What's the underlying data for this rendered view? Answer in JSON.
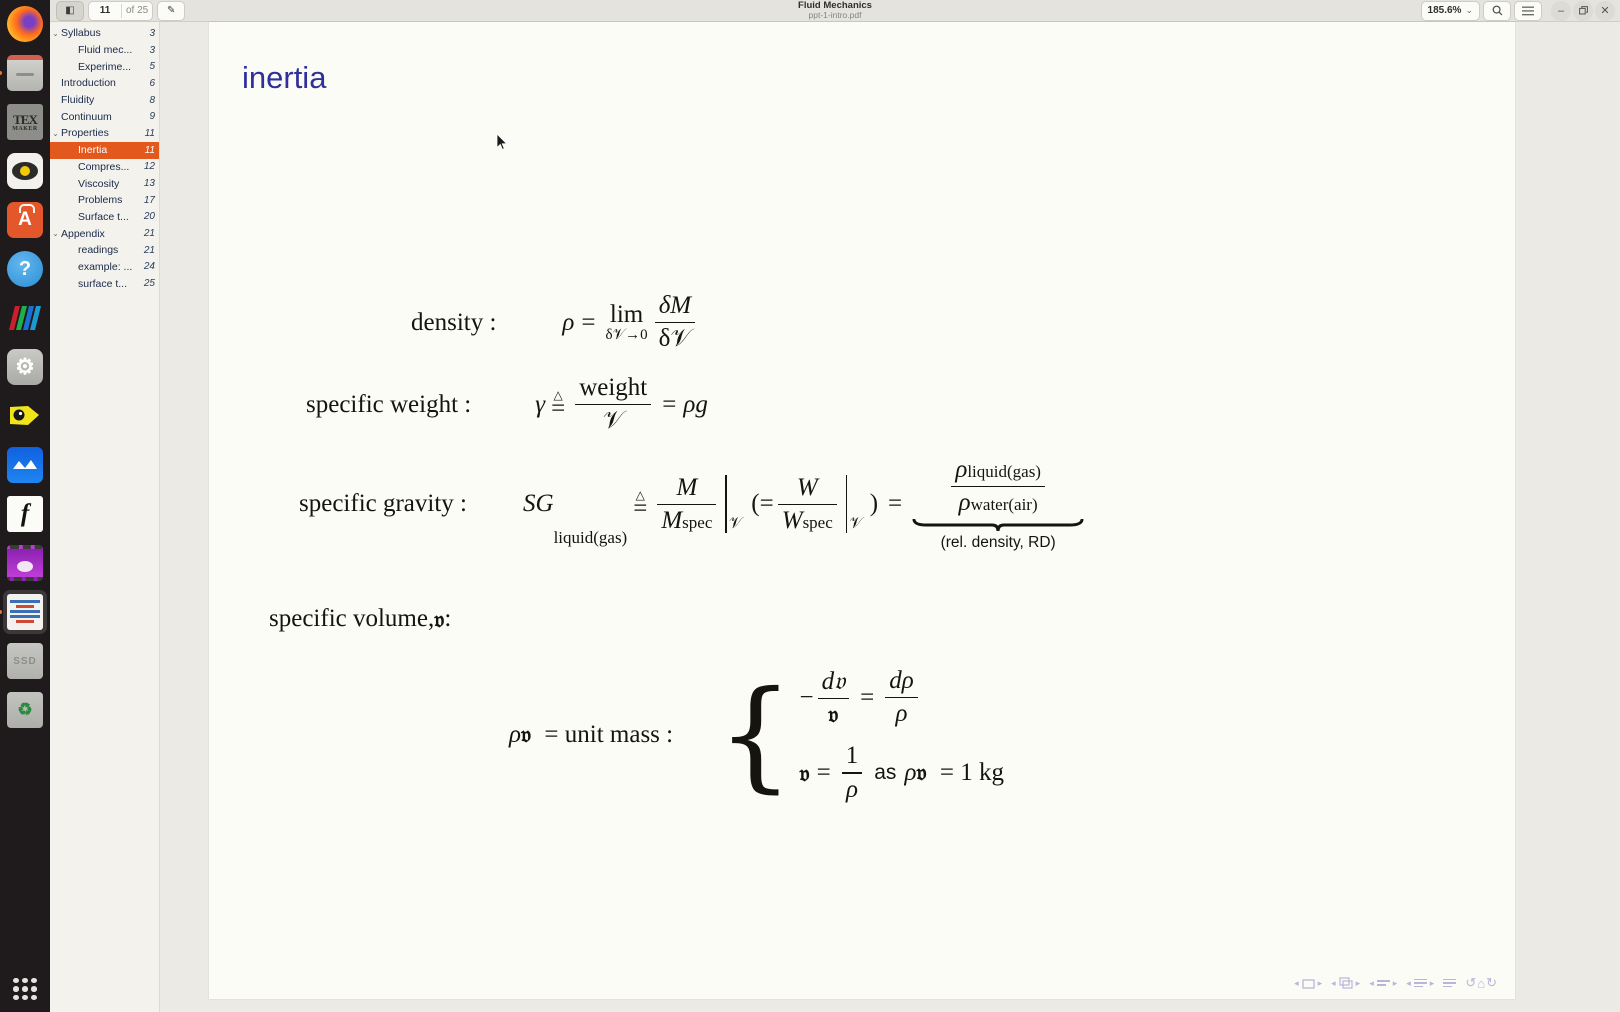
{
  "dock": {
    "items": [
      {
        "name": "firefox",
        "label": "Firefox",
        "running": false,
        "active": false
      },
      {
        "name": "files",
        "label": "Files",
        "running": true,
        "active": false
      },
      {
        "name": "texmaker",
        "label": "Texmaker",
        "tex_top": "TEX",
        "tex_bottom": "MAKER",
        "running": false,
        "active": false
      },
      {
        "name": "document-viewer",
        "label": "Document Viewer",
        "running": false,
        "active": false
      },
      {
        "name": "ubuntu-software",
        "label": "Ubuntu Software",
        "glyph": "A",
        "running": false,
        "active": false
      },
      {
        "name": "help",
        "label": "Help",
        "glyph": "?",
        "running": false,
        "active": false
      },
      {
        "name": "stripes-app",
        "label": "Color Stripes",
        "running": false,
        "active": false
      },
      {
        "name": "settings",
        "label": "Settings",
        "glyph": "⚙",
        "running": false,
        "active": false
      },
      {
        "name": "snake-app",
        "label": "Snake",
        "running": false,
        "active": false
      },
      {
        "name": "wave-app",
        "label": "Wave",
        "glyph": "▲▲",
        "running": false,
        "active": false
      },
      {
        "name": "font-app",
        "label": "Fonts",
        "glyph": "f",
        "running": false,
        "active": false
      },
      {
        "name": "video-app",
        "label": "Videos",
        "running": false,
        "active": false
      },
      {
        "name": "pdf-viewer",
        "label": "PDF Viewer",
        "running": true,
        "active": true
      },
      {
        "name": "ssd-drive",
        "label": "SSD",
        "glyph": "SSD",
        "running": false,
        "active": false
      },
      {
        "name": "trash",
        "label": "Trash",
        "glyph": "♻",
        "running": false,
        "active": false
      }
    ],
    "show_apps_label": "Show Applications"
  },
  "header": {
    "sidebar_toggle_label": "◧",
    "page_current": "11",
    "page_total": "of 25",
    "annotate_label": "✎",
    "title": "Fluid Mechanics",
    "subtitle": "ppt-1-intro.pdf",
    "zoom_value": "185.6%",
    "zoom_caret": "⌄",
    "search_label": "⚲",
    "menu_label": "☰",
    "minimize_label": "–",
    "maximize_label": "❐",
    "close_label": "✕"
  },
  "outline": {
    "selected_index": 7,
    "items": [
      {
        "label": "Syllabus",
        "page": "3",
        "level": 1,
        "twisty": "⌄"
      },
      {
        "label": "Fluid mec...",
        "page": "3",
        "level": 2,
        "twisty": ""
      },
      {
        "label": "Experime...",
        "page": "5",
        "level": 2,
        "twisty": ""
      },
      {
        "label": "Introduction",
        "page": "6",
        "level": 1,
        "twisty": ""
      },
      {
        "label": "Fluidity",
        "page": "8",
        "level": 1,
        "twisty": ""
      },
      {
        "label": "Continuum",
        "page": "9",
        "level": 1,
        "twisty": ""
      },
      {
        "label": "Properties",
        "page": "11",
        "level": 1,
        "twisty": "⌄"
      },
      {
        "label": "Inertia",
        "page": "11",
        "level": 2,
        "twisty": ""
      },
      {
        "label": "Compres...",
        "page": "12",
        "level": 2,
        "twisty": ""
      },
      {
        "label": "Viscosity",
        "page": "13",
        "level": 2,
        "twisty": ""
      },
      {
        "label": "Problems",
        "page": "17",
        "level": 2,
        "twisty": ""
      },
      {
        "label": "Surface t...",
        "page": "20",
        "level": 2,
        "twisty": ""
      },
      {
        "label": "Appendix",
        "page": "21",
        "level": 1,
        "twisty": "⌄"
      },
      {
        "label": "readings",
        "page": "21",
        "level": 2,
        "twisty": ""
      },
      {
        "label": "example: ...",
        "page": "24",
        "level": 2,
        "twisty": ""
      },
      {
        "label": "surface t...",
        "page": "25",
        "level": 2,
        "twisty": ""
      }
    ]
  },
  "slide": {
    "title": "inertia",
    "title_color": "#30309c",
    "density": {
      "label": "density :",
      "symbol": "ρ",
      "equals": "=",
      "lim_top": "lim",
      "lim_bottom": "δ𝒱→0",
      "num": "δM",
      "den": "δ𝒱"
    },
    "specific_weight": {
      "label": "specific weight :",
      "symbol": "γ",
      "defeq_tri": "△",
      "defeq_eq": "=",
      "num": "weight",
      "den": "𝒱",
      "equals": "=",
      "rhs": "ρg"
    },
    "specific_gravity": {
      "label": "specific gravity :",
      "symbol": "SG",
      "symbol_sub": "liquid(gas)",
      "defeq_tri": "△",
      "defeq_eq": "=",
      "frac1_num": "M",
      "frac1_den": "M",
      "frac1_den_sub": "spec",
      "eval1_sub": "𝒱",
      "open_paren_eq": "(=",
      "frac2_num": "W",
      "frac2_den": "W",
      "frac2_den_sub": "spec",
      "eval2_sub": "𝒱",
      "close_paren": ")",
      "equals": "=",
      "frac3_num": "ρ",
      "frac3_num_sub": "liquid(gas)",
      "frac3_den": "ρ",
      "frac3_den_sub": "water(air)",
      "underbrace_label": "(rel. density, RD)"
    },
    "specific_volume": {
      "label_pre": "specific volume, ",
      "symbol": "𝔳",
      "label_post": ":"
    },
    "unit_mass": {
      "lhs_rho": "ρ",
      "lhs_v": "𝔳",
      "lhs_rest": "= unit mass :",
      "brace": "{",
      "line1": {
        "minus": "−",
        "num": "d𝔳",
        "den": "𝔳",
        "equals": "=",
        "num2": "dρ",
        "den2": "ρ"
      },
      "line2": {
        "lhs": "𝔳",
        "equals": "=",
        "num": "1",
        "den": "ρ",
        "as": "as",
        "rhs_rho": "ρ",
        "rhs_v": "𝔳",
        "rhs_rest": "= 1 kg"
      }
    }
  },
  "beamer_nav": {
    "groups": [
      {
        "name": "frame-nav",
        "left": "◂",
        "icon": "frame",
        "right": "▸"
      },
      {
        "name": "subsection-nav",
        "left": "◂",
        "icon": "frames",
        "right": "▸"
      },
      {
        "name": "section-nav",
        "left": "◂",
        "icon": "bars2",
        "right": "▸"
      },
      {
        "name": "doc-nav",
        "left": "◂",
        "icon": "bars3",
        "right": "▸"
      },
      {
        "name": "back-nav",
        "left": "",
        "icon": "bars3",
        "right": ""
      }
    ],
    "extras": [
      "↺",
      "⌂",
      "↻"
    ]
  },
  "colors": {
    "accent_orange": "#e2581d",
    "title_blue": "#30309c",
    "header_bg": "#e4e3dd",
    "sidebar_bg": "#f3f2ec",
    "page_bg": "#fcfcf6",
    "nav_purple": "#b7b6d8"
  }
}
